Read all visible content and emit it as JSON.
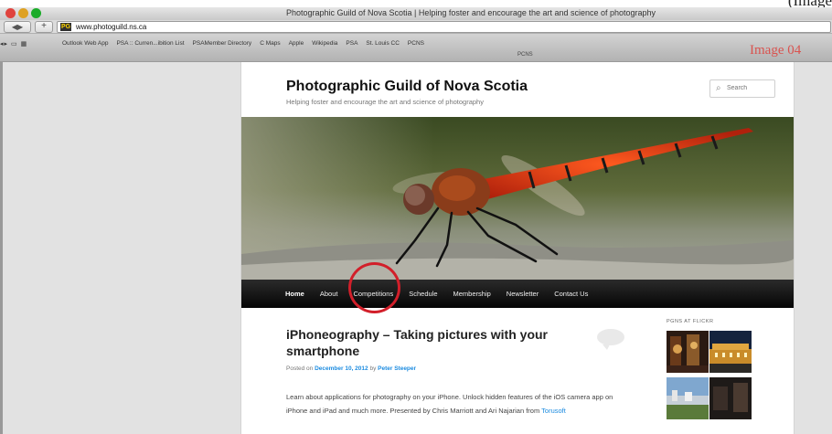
{
  "page_caption_fragment": "(Image",
  "window": {
    "title": "Photographic Guild of Nova Scotia | Helping foster and encourage the art and science of photography"
  },
  "toolbar": {
    "back_label": "◀",
    "forward_label": "▶",
    "add_label": "+",
    "favicon_text": "PG",
    "url": "www.photoguild.ns.ca"
  },
  "bookmarks": {
    "items": [
      "Outlook Web App",
      "PSA :: Curren...ibition List",
      "PSAMember Directory",
      "C Maps",
      "Apple",
      "Wikipedia",
      "PSA",
      "St. Louis CC",
      "PCNS"
    ],
    "tab_label": "PCNS",
    "image_label": "Image 04"
  },
  "site": {
    "title": "Photographic Guild of Nova Scotia",
    "description": "Helping foster and encourage the art and science of photography",
    "search_placeholder": "Search",
    "nav": [
      "Home",
      "About",
      "Competitions",
      "Schedule",
      "Membership",
      "Newsletter",
      "Contact Us"
    ],
    "post": {
      "title": "iPhoneography – Taking pictures with your smartphone",
      "meta_prefix": "Posted on",
      "date": "December 10, 2012",
      "by": "by",
      "author": "Peter Steeper",
      "body": "Learn about applications for photography on your iPhone. Unlock hidden features of the iOS camera app on iPhone and iPad and much more. Presented by Chris Marriott and Ari Najarian from",
      "body_link": "Torusoft"
    },
    "sidebar": {
      "widget_title": "PGNS AT FLICKR"
    }
  },
  "colors": {
    "highlight_circle": "#d21f2a",
    "link": "#1b8be0",
    "nav_bg": "#050505"
  }
}
